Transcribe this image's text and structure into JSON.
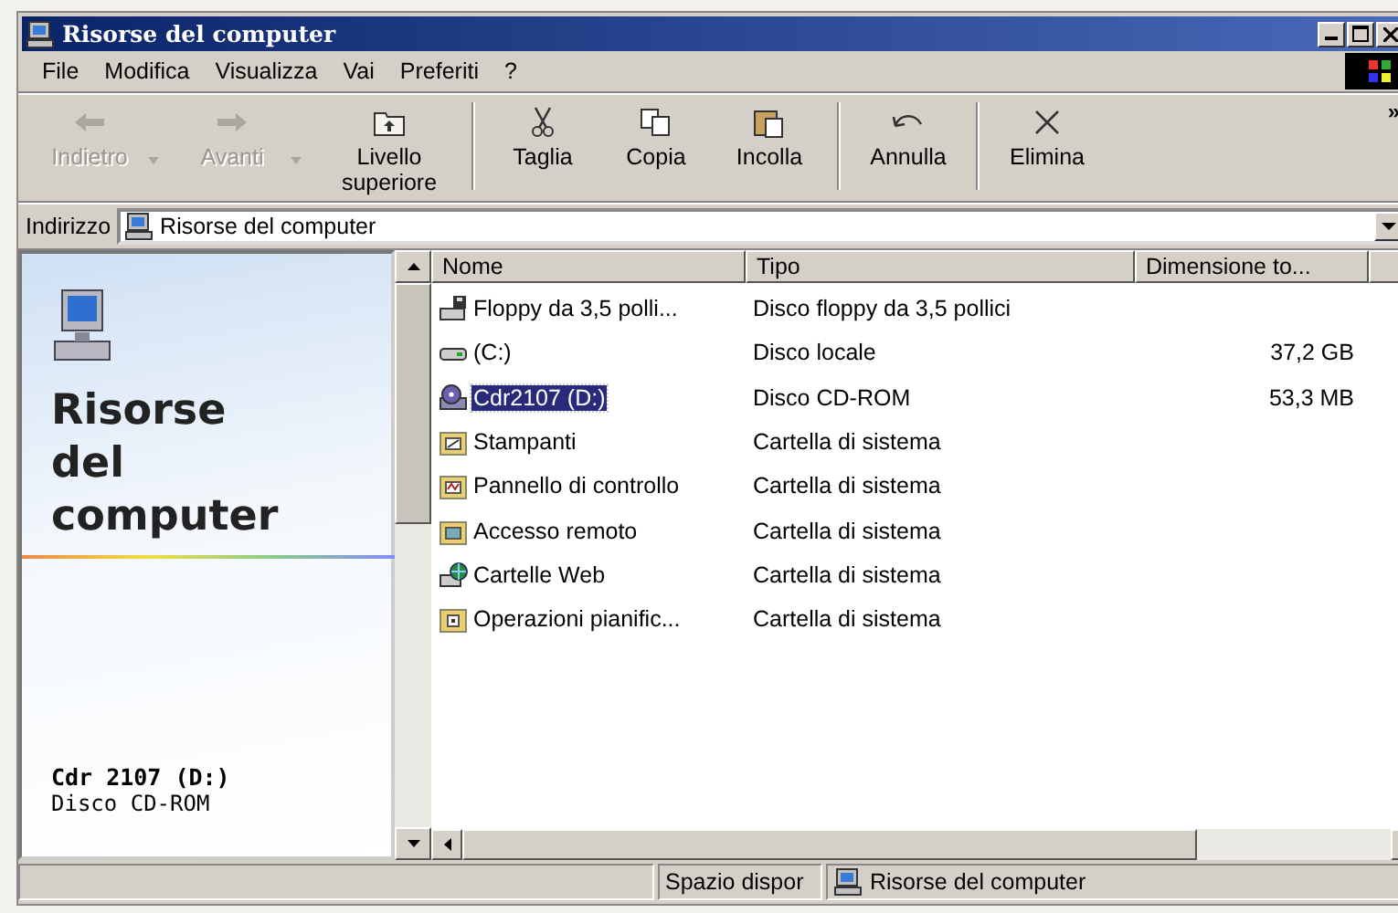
{
  "window": {
    "title": "Risorse del computer"
  },
  "menu": [
    {
      "label": "File"
    },
    {
      "label": "Modifica"
    },
    {
      "label": "Visualizza"
    },
    {
      "label": "Vai"
    },
    {
      "label": "Preferiti"
    },
    {
      "label": "?"
    }
  ],
  "toolbar": [
    {
      "kind": "back",
      "label": "Indietro",
      "disabled": true,
      "dropdown": true
    },
    {
      "kind": "forward",
      "label": "Avanti",
      "disabled": true,
      "dropdown": true
    },
    {
      "kind": "up",
      "label": "Livello superiore",
      "disabled": false,
      "dropdown": false
    },
    {
      "kind": "cut",
      "label": "Taglia",
      "disabled": false,
      "dropdown": false
    },
    {
      "kind": "copy",
      "label": "Copia",
      "disabled": false,
      "dropdown": false
    },
    {
      "kind": "paste",
      "label": "Incolla",
      "disabled": false,
      "dropdown": false
    },
    {
      "kind": "undo",
      "label": "Annulla",
      "disabled": false,
      "dropdown": false
    },
    {
      "kind": "delete",
      "label": "Elimina",
      "disabled": false,
      "dropdown": false
    }
  ],
  "toolbar_more": "»",
  "address": {
    "label": "Indirizzo",
    "value": "Risorse del computer"
  },
  "left_pane": {
    "heading": "Risorse del computer",
    "detail_title": "Cdr 2107 (D:)",
    "detail_subtitle": "Disco CD-ROM"
  },
  "table": {
    "columns": [
      "Nome",
      "Tipo",
      "Dimensione to..."
    ],
    "rows": [
      {
        "kind": "floppy",
        "name": "Floppy da 3,5 polli...",
        "type": "Disco floppy da 3,5 pollici",
        "size": "",
        "selected": false
      },
      {
        "kind": "disk",
        "name": "(C:)",
        "type": "Disco locale",
        "size": "37,2 GB",
        "selected": false
      },
      {
        "kind": "cdrom",
        "name": "Cdr2107 (D:)",
        "type": "Disco CD-ROM",
        "size": "53,3 MB",
        "selected": true
      },
      {
        "kind": "printers",
        "name": "Stampanti",
        "type": "Cartella di sistema",
        "size": "",
        "selected": false
      },
      {
        "kind": "control",
        "name": "Pannello di controllo",
        "type": "Cartella di sistema",
        "size": "",
        "selected": false
      },
      {
        "kind": "dialup",
        "name": "Accesso remoto",
        "type": "Cartella di sistema",
        "size": "",
        "selected": false
      },
      {
        "kind": "web",
        "name": "Cartelle Web",
        "type": "Cartella di sistema",
        "size": "",
        "selected": false
      },
      {
        "kind": "tasks",
        "name": "Operazioni pianific...",
        "type": "Cartella di sistema",
        "size": "",
        "selected": false
      }
    ]
  },
  "status_bar": {
    "free_space": "Spazio dispor",
    "location": "Risorse del computer"
  }
}
